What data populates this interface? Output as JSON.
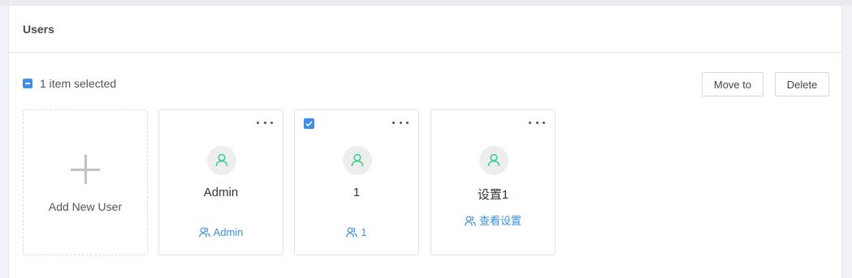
{
  "panel": {
    "title": "Users"
  },
  "toolbar": {
    "selected_text": "1 item selected",
    "move_label": "Move to",
    "delete_label": "Delete"
  },
  "add_card": {
    "label": "Add New User"
  },
  "users": [
    {
      "name": "Admin",
      "role": "Admin",
      "selected": false
    },
    {
      "name": "1",
      "role": "1",
      "selected": true
    },
    {
      "name": "设置1",
      "role": "查看设置",
      "selected": false
    }
  ],
  "colors": {
    "accent": "#3d8fe6",
    "avatar_icon": "#3ccf8e",
    "avatar_bg": "#eeeeee"
  },
  "icons": {
    "add": "plus-icon",
    "more": "more-dots-icon",
    "avatar": "user-icon",
    "role": "users-group-icon",
    "checkbox": "checkbox-checked-icon"
  }
}
